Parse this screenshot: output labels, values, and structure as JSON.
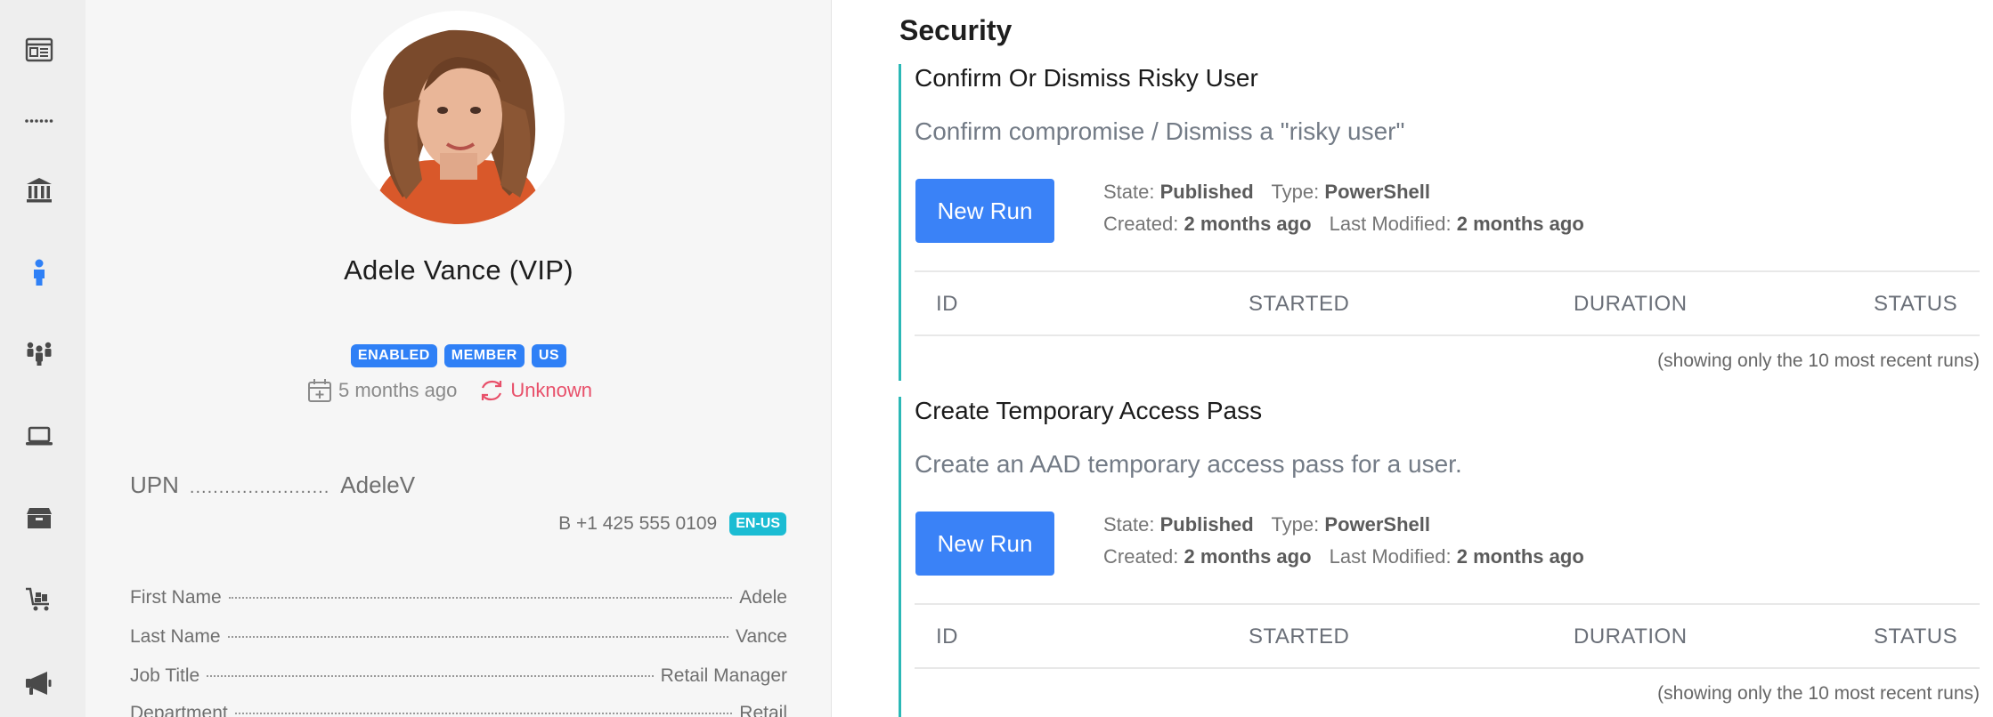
{
  "sidebar": {
    "items": [
      {
        "icon": "dashboard-icon"
      },
      {
        "icon": "more-dots-icon"
      },
      {
        "icon": "bank-icon"
      },
      {
        "icon": "user-icon",
        "active": true
      },
      {
        "icon": "groups-icon"
      },
      {
        "icon": "laptop-icon"
      },
      {
        "icon": "box-icon"
      },
      {
        "icon": "cart-icon"
      },
      {
        "icon": "megaphone-icon"
      }
    ],
    "active_color": "#2f80f6"
  },
  "profile": {
    "name": "Adele Vance (VIP)",
    "badges": [
      "ENABLED",
      "MEMBER",
      "US"
    ],
    "created": "5 months ago",
    "sync_status": "Unknown",
    "upn_label": "UPN",
    "upn_value": "AdeleV",
    "phone": "B +1 425 555 0109",
    "locale": "EN-US",
    "fields": [
      {
        "label": "First Name",
        "value": "Adele"
      },
      {
        "label": "Last Name",
        "value": "Vance"
      },
      {
        "label": "Job Title",
        "value": "Retail Manager"
      },
      {
        "label": "Department",
        "value": "Retail"
      }
    ]
  },
  "security": {
    "title": "Security",
    "runbooks": [
      {
        "title": "Confirm Or Dismiss Risky User",
        "description": "Confirm compromise / Dismiss a \"risky user\"",
        "button": "New Run",
        "state_label": "State:",
        "state": "Published",
        "type_label": "Type:",
        "type": "PowerShell",
        "created_label": "Created:",
        "created": "2 months ago",
        "modified_label": "Last Modified:",
        "modified": "2 months ago",
        "columns": [
          "ID",
          "STARTED",
          "DURATION",
          "STATUS"
        ],
        "note": "(showing only the 10 most recent runs)"
      },
      {
        "title": "Create Temporary Access Pass",
        "description": "Create an AAD temporary access pass for a user.",
        "button": "New Run",
        "state_label": "State:",
        "state": "Published",
        "type_label": "Type:",
        "type": "PowerShell",
        "created_label": "Created:",
        "created": "2 months ago",
        "modified_label": "Last Modified:",
        "modified": "2 months ago",
        "columns": [
          "ID",
          "STARTED",
          "DURATION",
          "STATUS"
        ],
        "note": "(showing only the 10 most recent runs)"
      }
    ]
  },
  "colors": {
    "primary_button": "#3a82f7",
    "badge_blue": "#2f80f6",
    "locale_badge": "#1bbcd3",
    "sync_unknown": "#e8506a",
    "accent_border": "#2bb8b6"
  }
}
